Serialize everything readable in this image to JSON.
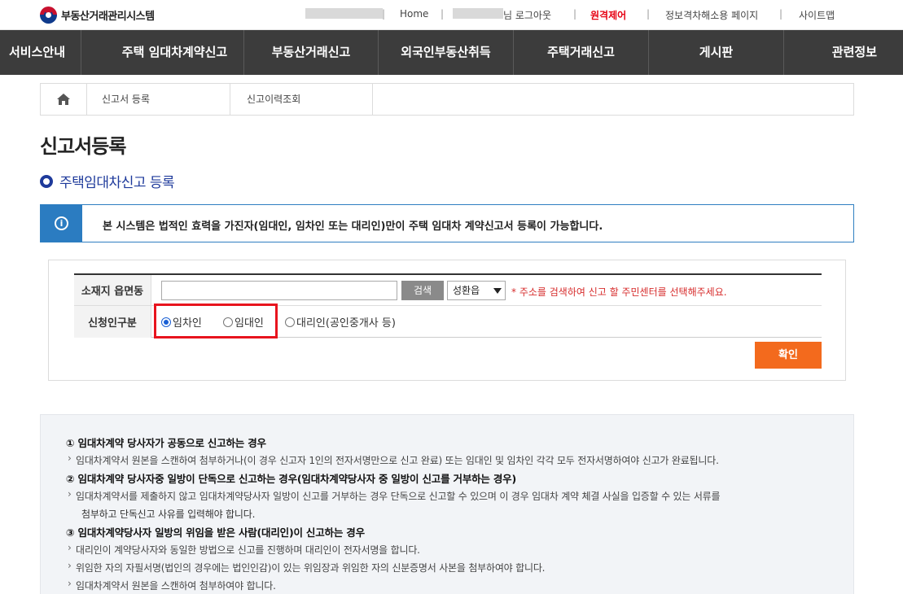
{
  "header": {
    "site_name": "부동산거래관리시스템",
    "util": {
      "home": "Home",
      "user_suffix": "님 로그아웃",
      "remote": "원격제어",
      "privacy": "정보격차해소용 페이지",
      "sitemap": "사이트맵"
    }
  },
  "nav": [
    "서비스안내",
    "주택 임대차계약신고",
    "부동산거래신고",
    "외국인부동산취득",
    "주택거래신고",
    "게시판",
    "관련정보"
  ],
  "breadcrumb": {
    "items": [
      "신고서 등록",
      "신고이력조회"
    ]
  },
  "page_title": "신고서등록",
  "section_title": "주택임대차신고 등록",
  "notice": "본 시스템은 법적인 효력을 가진자(임대인, 임차인 또는 대리인)만이 주택 임대차 계약신고서 등록이 가능합니다.",
  "form": {
    "location_label": "소재지 읍면동",
    "location_value": "",
    "search_label": "검색",
    "select_value": "성환읍",
    "hint": "* 주소를 검색하여 신고 할 주민센터를 선택해주세요.",
    "applicant_label": "신청인구분",
    "options": [
      {
        "label": "임차인",
        "checked": true
      },
      {
        "label": "임대인",
        "checked": false
      },
      {
        "label": "대리인(공인중개사 등)",
        "checked": false
      }
    ],
    "confirm_label": "확인"
  },
  "guide": {
    "h1": "① 임대차계약 당사자가 공동으로 신고하는 경우",
    "b1": "임대차계약서 원본을 스캔하여 첨부하거나(이 경우 신고자 1인의 전자서명만으로 신고 완료) 또는 임대인 및 임차인 각각 모두 전자서명하여야 신고가 완료됩니다.",
    "h2": "② 임대차계약 당사자중 일방이 단독으로 신고하는 경우(임대차계약당사자 중 일방이 신고를 거부하는 경우)",
    "b2": "임대차계약서를 제출하지 않고 임대차계약당사자 일방이 신고를 거부하는 경우 단독으로 신고할 수 있으며 이 경우 임대차 계약 체결 사실을 입증할 수 있는 서류를",
    "b2c": "첨부하고 단독신고 사유를 입력해야 합니다.",
    "h3": "③ 임대차계약당사자 일방의 위임을 받은 사람(대리인)이 신고하는 경우",
    "b3": "대리인이 계약당사자와 동일한 방법으로 신고를 진행하며 대리인이 전자서명을 합니다.",
    "b4": "위임한 자의 자필서명(법인의 경우에는 법인인감)이 있는 위임장과 위임한 자의 신분증명서 사본을 첨부하여야 합니다.",
    "b5": "임대차계약서 원본을 스캔하여 첨부하여야 합니다."
  }
}
